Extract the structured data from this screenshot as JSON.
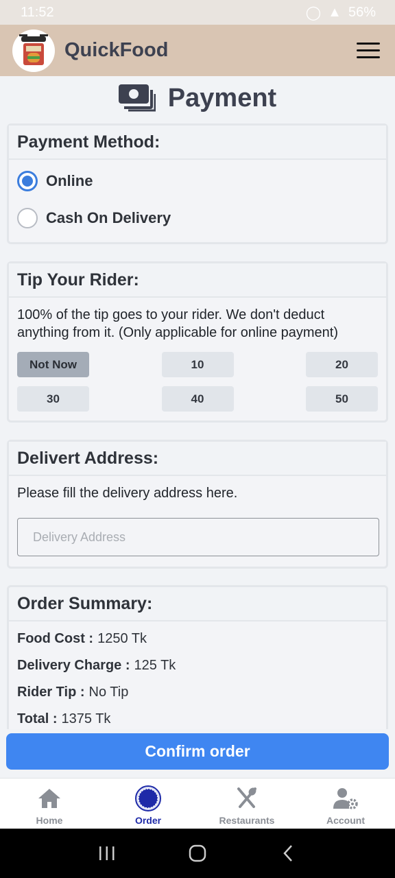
{
  "status_bar": {
    "time": "11:52",
    "battery": "56%"
  },
  "app": {
    "title": "QuickFood"
  },
  "page": {
    "title": "Payment"
  },
  "payment_method": {
    "heading": "Payment Method:",
    "options": [
      {
        "label": "Online",
        "selected": true
      },
      {
        "label": "Cash On Delivery",
        "selected": false
      }
    ]
  },
  "tip": {
    "heading": "Tip Your Rider:",
    "description": "100% of the tip goes to your rider. We don't deduct anything from it. (Only applicable for online payment)",
    "options": [
      "Not Now",
      "10",
      "20",
      "30",
      "40",
      "50"
    ],
    "selected": "Not Now"
  },
  "address": {
    "heading": "Delivert Address:",
    "hint": "Please fill the delivery address here.",
    "placeholder": "Delivery Address",
    "value": ""
  },
  "summary": {
    "heading": "Order Summary:",
    "rows": [
      {
        "label": "Food Cost :",
        "value": "1250 Tk"
      },
      {
        "label": "Delivery Charge :",
        "value": "125 Tk"
      },
      {
        "label": "Rider Tip :",
        "value": "No Tip"
      },
      {
        "label": "Total :",
        "value": "1375 Tk"
      }
    ]
  },
  "confirm_label": "Confirm order",
  "bottom_nav": {
    "items": [
      {
        "label": "Home",
        "icon": "home-icon"
      },
      {
        "label": "Order",
        "icon": "order-icon",
        "active": true
      },
      {
        "label": "Restaurants",
        "icon": "utensils-icon"
      },
      {
        "label": "Account",
        "icon": "user-gear-icon"
      }
    ]
  },
  "colors": {
    "accent": "#3f86f1",
    "appbar": "#d9c5b3",
    "active_nav": "#1e2aa8"
  }
}
